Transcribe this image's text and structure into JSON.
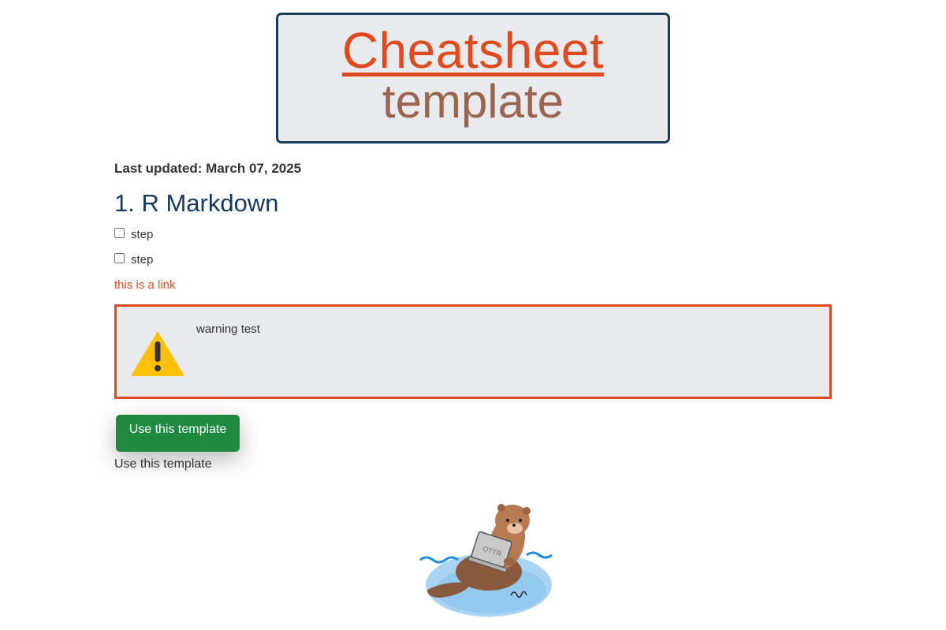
{
  "header": {
    "title_line1": "Cheatsheet",
    "title_line2": "template"
  },
  "meta": {
    "last_updated": "Last updated: March 07, 2025"
  },
  "section": {
    "heading": "1. R Markdown",
    "steps": [
      {
        "label": "step",
        "checked": false
      },
      {
        "label": "step",
        "checked": false
      }
    ],
    "link_text": "this is a link"
  },
  "warning": {
    "icon": "warning-triangle-icon",
    "text": "warning test"
  },
  "cta": {
    "button_label": "Use this template",
    "caption": "Use this template"
  },
  "illustration": {
    "name": "otter-with-laptop-illustration",
    "laptop_text": "OTTR"
  },
  "colors": {
    "accent": "#e04a1f",
    "title_border": "#1b3a5c",
    "subtitle": "#9a6650",
    "heading": "#133a5e",
    "button": "#1f8a3f",
    "panel_bg": "#e8eaed",
    "warning_icon": "#ffc107"
  }
}
